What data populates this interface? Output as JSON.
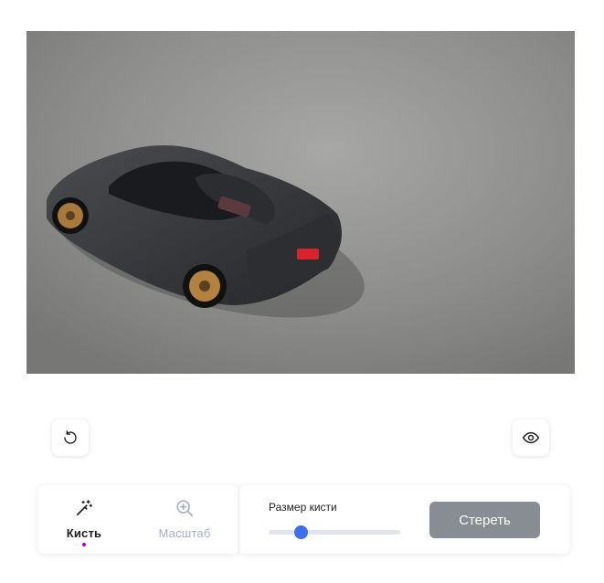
{
  "image": {
    "description_icon": "car-photo"
  },
  "controls": {
    "reset_icon": "rotate-ccw-icon",
    "preview_icon": "eye-icon"
  },
  "tools": {
    "brush": {
      "label": "Кисть",
      "icon": "magic-wand-icon",
      "active": true
    },
    "zoom": {
      "label": "Масштаб",
      "icon": "zoom-in-icon",
      "active": false
    }
  },
  "brush_settings": {
    "size_label": "Размер кисти",
    "size_value_fraction": 0.24,
    "erase_label": "Стереть"
  },
  "colors": {
    "accent": "#3c6ff0",
    "active_dot": "#b400d8",
    "erase_button": "#888c93",
    "inactive_label": "#a8afbf"
  }
}
